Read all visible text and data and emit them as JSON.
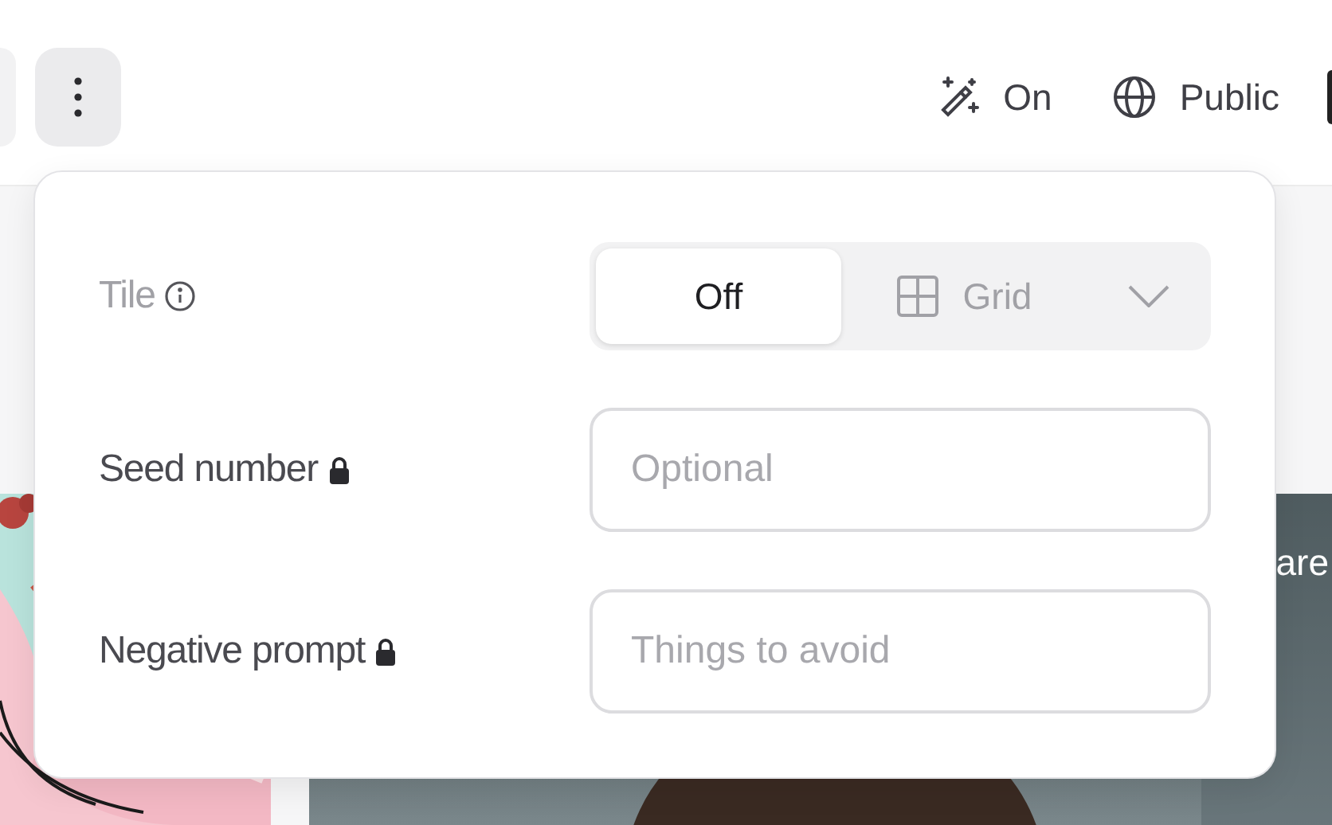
{
  "toolbar": {
    "magic": {
      "label": "On"
    },
    "visibility": {
      "label": "Public"
    }
  },
  "settings": {
    "tile": {
      "label": "Tile",
      "disabled": true,
      "options": [
        {
          "label": "Off",
          "selected": true
        },
        {
          "label": "Grid",
          "selected": false
        }
      ]
    },
    "fields": [
      {
        "label": "Seed number",
        "locked": true,
        "placeholder": "Optional"
      },
      {
        "label": "Negative prompt",
        "locked": true,
        "placeholder": "Things to avoid"
      }
    ]
  },
  "gallery": {
    "caption": "are"
  }
}
